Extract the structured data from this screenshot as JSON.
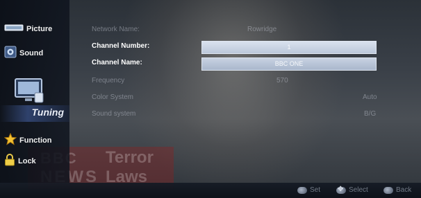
{
  "sidebar": {
    "items": [
      {
        "label": "Picture",
        "icon": "picture-icon"
      },
      {
        "label": "Sound",
        "icon": "sound-icon"
      },
      {
        "label": "Tuning",
        "icon": "tuning-icon"
      },
      {
        "label": "Function",
        "icon": "function-icon"
      },
      {
        "label": "Lock",
        "icon": "lock-icon"
      }
    ],
    "selected": "Tuning"
  },
  "settings": {
    "network_name": {
      "label": "Network Name:",
      "value": "Rowridge"
    },
    "channel_number": {
      "label": "Channel Number:",
      "value": "1"
    },
    "channel_name": {
      "label": "Channel Name:",
      "value": "BBC ONE"
    },
    "frequency": {
      "label": "Frequency",
      "value": "570"
    },
    "color_system": {
      "label": "Color System",
      "value": "Auto"
    },
    "sound_system": {
      "label": "Sound system",
      "value": "B/G"
    }
  },
  "background": {
    "logo_line1": "BBC",
    "logo_line2": "NEWS",
    "headline_line1": "Terror",
    "headline_line2": "Laws"
  },
  "hints": [
    {
      "key": "OK",
      "label": "Set"
    },
    {
      "key": "nav",
      "label": "Select"
    },
    {
      "key": "menu",
      "label": "Back"
    }
  ]
}
